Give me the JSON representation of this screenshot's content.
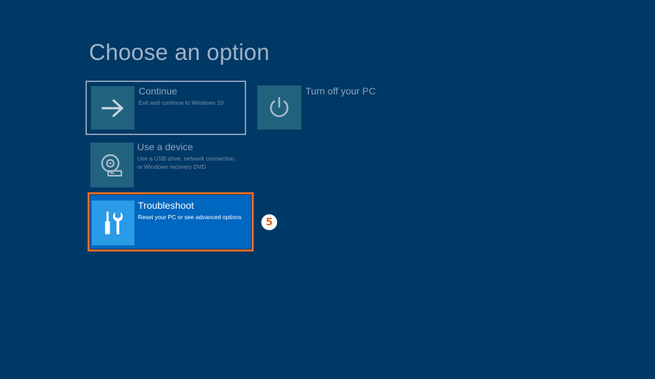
{
  "page": {
    "title": "Choose an option"
  },
  "options": {
    "continue": {
      "label": "Continue",
      "description": "Exit and continue to Windows 10",
      "icon": "arrow-right-icon"
    },
    "turn_off": {
      "label": "Turn off your PC",
      "icon": "power-icon"
    },
    "use_device": {
      "label": "Use a device",
      "description_lines": [
        "Use a USB drive, network connection,",
        "or Windows recovery DVD"
      ],
      "icon": "disc-drive-icon"
    },
    "troubleshoot": {
      "label": "Troubleshoot",
      "description": "Reset your PC or see advanced options",
      "icon": "tools-icon",
      "highlight_color": "#e06b23"
    }
  },
  "annotation": {
    "step_number": "5"
  },
  "colors": {
    "background": "#003866",
    "tile_icon_bg": "#21627f",
    "selected_tile_bg": "#0067c0",
    "selected_icon_bg": "#2a9be6",
    "highlight_border": "#e06b23"
  }
}
